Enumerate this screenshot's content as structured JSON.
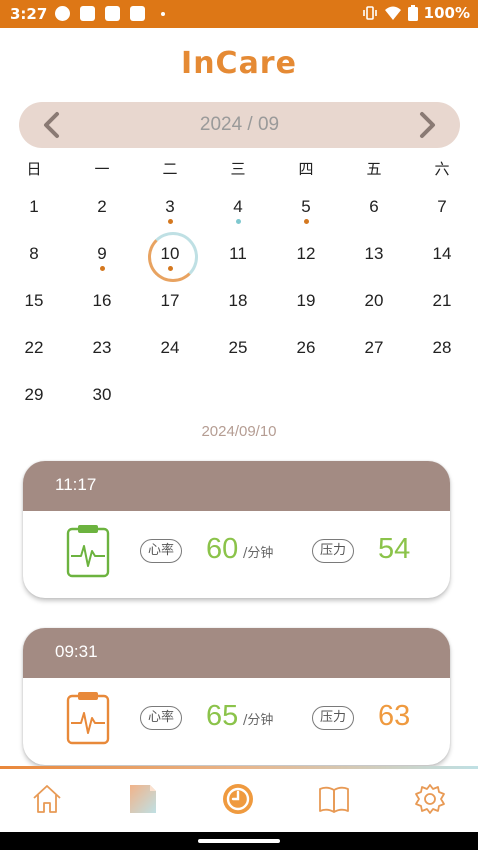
{
  "status_bar": {
    "time": "3:27",
    "battery": "100%",
    "icons": [
      "app-notification-icon",
      "notification-icon",
      "notification-icon",
      "notification-icon",
      "more-dot-icon",
      "vibrate-icon",
      "wifi-icon",
      "battery-icon"
    ]
  },
  "app": {
    "title": "InCare"
  },
  "calendar": {
    "month_label": "2024 / 09",
    "prev_icon": "chevron-left-icon",
    "next_icon": "chevron-right-icon",
    "weekdays": [
      "日",
      "一",
      "二",
      "三",
      "四",
      "五",
      "六"
    ],
    "days": [
      "1",
      "2",
      "3",
      "4",
      "5",
      "6",
      "7",
      "8",
      "9",
      "10",
      "11",
      "12",
      "13",
      "14",
      "15",
      "16",
      "17",
      "18",
      "19",
      "20",
      "21",
      "22",
      "23",
      "24",
      "25",
      "26",
      "27",
      "28",
      "29",
      "30"
    ],
    "selected_day": "10",
    "marked_days": [
      {
        "day": "3",
        "color": "#d4781f"
      },
      {
        "day": "4",
        "color": "#7fc8cf"
      },
      {
        "day": "5",
        "color": "#d4781f"
      },
      {
        "day": "9",
        "color": "#d4781f"
      },
      {
        "day": "10",
        "color": "#d4781f"
      }
    ]
  },
  "selected_date": "2024/09/10",
  "records": [
    {
      "time": "11:17",
      "heart_rate_label": "心率",
      "heart_rate": "60",
      "unit": "/分钟",
      "stress_label": "压力",
      "stress": "54",
      "stress_color": "#8bc34a",
      "icon_color": "#6cb33f"
    },
    {
      "time": "09:31",
      "heart_rate_label": "心率",
      "heart_rate": "65",
      "unit": "/分钟",
      "stress_label": "压力",
      "stress": "63",
      "stress_color": "#ef9a3f",
      "icon_color": "#e8893a"
    }
  ],
  "bottom_nav": {
    "items": [
      "home-icon",
      "report-icon",
      "history-icon",
      "guide-book-icon",
      "settings-icon"
    ],
    "active": "history-icon"
  },
  "colors": {
    "accent": "#dd7716",
    "title": "#e58a34",
    "card_header": "#a38b83",
    "month_bar": "#e8d7cf",
    "green": "#8bc34a"
  }
}
